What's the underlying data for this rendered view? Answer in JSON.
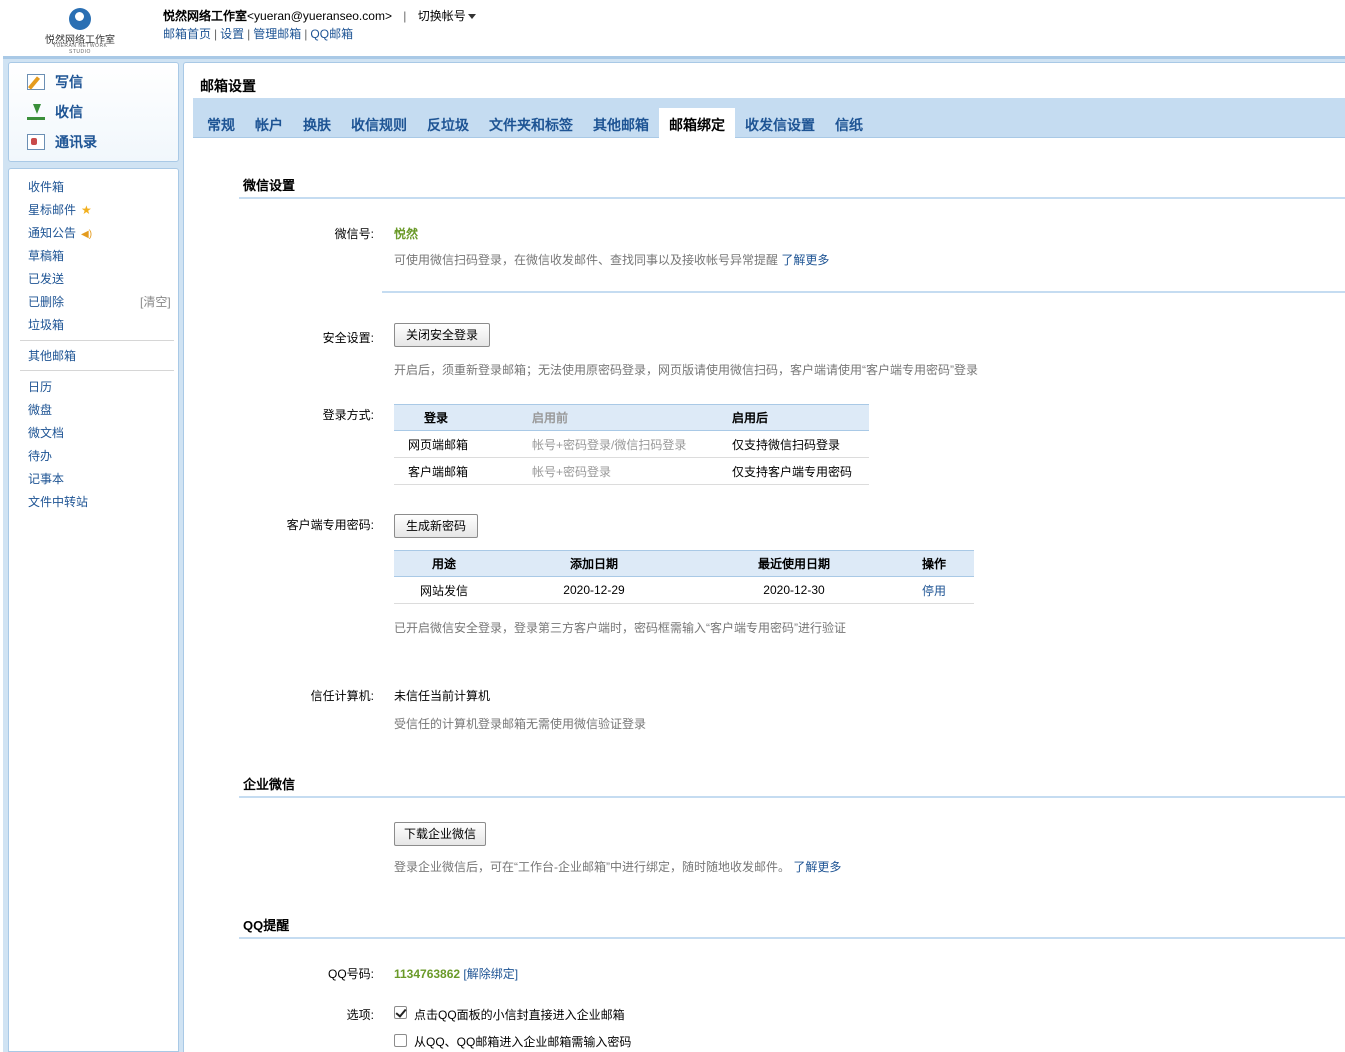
{
  "header": {
    "logo_text": "悦然网络工作室",
    "logo_subtext": "YUERAN NETWORK STUDIO",
    "account_name": "悦然网络工作室",
    "account_email": "<yueran@yueranseo.com>",
    "separator": "|",
    "switch_account": "切换帐号",
    "links": [
      "邮箱首页",
      "设置",
      "管理邮箱",
      "QQ邮箱"
    ]
  },
  "sidebar": {
    "quick": [
      {
        "label": "写信",
        "icon": "write-icon"
      },
      {
        "label": "收信",
        "icon": "inbox-icon"
      },
      {
        "label": "通讯录",
        "icon": "contacts-icon"
      }
    ],
    "folders": [
      "收件箱",
      "星标邮件",
      "通知公告",
      "草稿箱",
      "已发送",
      "已删除",
      "垃圾箱"
    ],
    "clear_label": "[清空]",
    "other_mailbox": "其他邮箱",
    "apps": [
      "日历",
      "微盘",
      "微文档",
      "待办",
      "记事本",
      "文件中转站"
    ]
  },
  "main": {
    "title": "邮箱设置",
    "tabs": [
      "常规",
      "帐户",
      "换肤",
      "收信规则",
      "反垃圾",
      "文件夹和标签",
      "其他邮箱",
      "邮箱绑定",
      "收发信设置",
      "信纸"
    ],
    "active_tab": "邮箱绑定"
  },
  "wechat": {
    "section_title": "微信设置",
    "wechat_id_label": "微信号:",
    "wechat_id": "悦然",
    "wechat_hint": "可使用微信扫码登录，在微信收发邮件、查找同事以及接收帐号异常提醒",
    "learn_more": "了解更多",
    "security_label": "安全设置:",
    "security_button": "关闭安全登录",
    "security_hint": "开启后，须重新登录邮箱；无法使用原密码登录，网页版请使用微信扫码，客户端请使用“客户端专用密码”登录",
    "login_method_label": "登录方式:",
    "login_table": {
      "headers": [
        "登录",
        "启用前",
        "启用后"
      ],
      "rows": [
        [
          "网页端邮箱",
          "帐号+密码登录/微信扫码登录",
          "仅支持微信扫码登录"
        ],
        [
          "客户端邮箱",
          "帐号+密码登录",
          "仅支持客户端专用密码"
        ]
      ]
    },
    "client_pwd_label": "客户端专用密码:",
    "generate_button": "生成新密码",
    "pwd_table": {
      "headers": [
        "用途",
        "添加日期",
        "最近使用日期",
        "操作"
      ],
      "rows": [
        [
          "网站发信",
          "2020-12-29",
          "2020-12-30",
          "停用"
        ]
      ]
    },
    "pwd_hint": "已开启微信安全登录，登录第三方客户端时，密码框需输入“客户端专用密码”进行验证",
    "trust_label": "信任计算机:",
    "trust_value": "未信任当前计算机",
    "trust_hint": "受信任的计算机登录邮箱无需使用微信验证登录"
  },
  "work_wechat": {
    "section_title": "企业微信",
    "download_button": "下载企业微信",
    "hint": "登录企业微信后，可在“工作台-企业邮箱”中进行绑定，随时随地收发邮件。",
    "learn_more": "了解更多"
  },
  "qq_reminder": {
    "section_title": "QQ提醒",
    "qq_label": "QQ号码:",
    "qq_number": "1134763862",
    "unbind": "[解除绑定]",
    "options_label": "选项:",
    "options": [
      {
        "label": "点击QQ面板的小信封直接进入企业邮箱",
        "checked": true
      },
      {
        "label": "从QQ、QQ邮箱进入企业邮箱需输入密码",
        "checked": false
      }
    ]
  }
}
